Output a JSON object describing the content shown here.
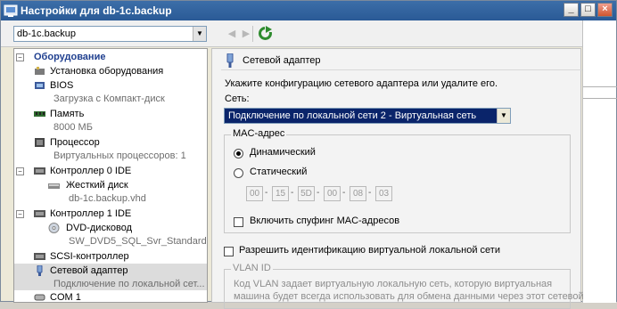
{
  "window": {
    "title": "Настройки для db-1c.backup",
    "min_label": "_",
    "max_label": "□",
    "close_label": "×"
  },
  "toolbar": {
    "vm_selected": "db-1c.backup",
    "back_label": "◀",
    "forward_label": "▶"
  },
  "tree": {
    "section_header": "Оборудование",
    "items": [
      {
        "label": "Установка оборудования"
      },
      {
        "label": "BIOS",
        "sub": "Загрузка с Компакт-диск"
      },
      {
        "label": "Память",
        "sub": "8000 МБ"
      },
      {
        "label": "Процессор",
        "sub": "Виртуальных процессоров: 1"
      },
      {
        "label": "Контроллер 0 IDE"
      },
      {
        "label": "Жесткий диск",
        "sub": "db-1c.backup.vhd"
      },
      {
        "label": "Контроллер 1 IDE"
      },
      {
        "label": "DVD-дисковод",
        "sub": "SW_DVD5_SQL_Svr_Standard..."
      },
      {
        "label": "SCSI-контроллер"
      },
      {
        "label": "Сетевой адаптер",
        "sub": "Подключение по локальной сет..."
      },
      {
        "label": "COM 1"
      }
    ]
  },
  "panel": {
    "title": "Сетевой адаптер",
    "description": "Укажите конфигурацию сетевого адаптера или удалите его.",
    "network_label": "Сеть:",
    "network_value": "Подключение по локальной сети 2 - Виртуальная сеть",
    "mac_group_label": "MAC-адрес",
    "mac_dynamic_label": "Динамический",
    "mac_static_label": "Статический",
    "mac_octets": [
      "00",
      "15",
      "5D",
      "00",
      "08",
      "03"
    ],
    "mac_spoofing_label": "Включить спуфинг MAC-адресов",
    "vlan_enable_label": "Разрешить идентификацию виртуальной локальной сети",
    "vlan_group_label": "VLAN ID",
    "vlan_desc_line1": "Код VLAN задает виртуальную локальную сеть, которую виртуальная",
    "vlan_desc_line2": "машина будет всегда использовать для обмена данными через этот сетевой"
  },
  "colors": {
    "title_bar": "#2a5a96",
    "selection": "#0a246a",
    "section_header": "#1f3f8f"
  }
}
